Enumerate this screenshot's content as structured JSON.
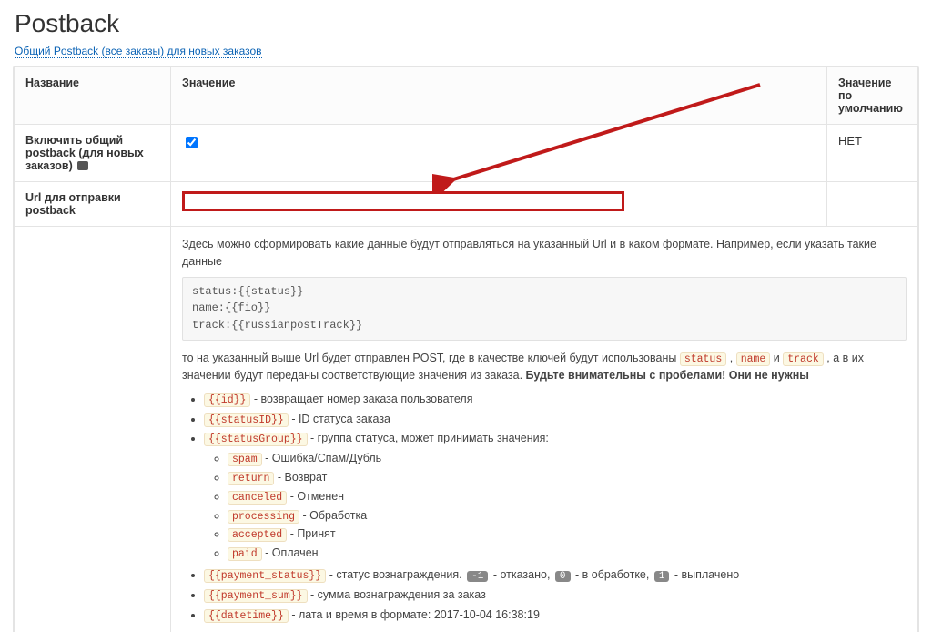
{
  "page": {
    "title": "Postback",
    "link_text": "Общий Postback (все заказы) для новых заказов"
  },
  "headers": {
    "name": "Название",
    "value": "Значение",
    "default": "Значение по умолчанию"
  },
  "rows": {
    "enable": {
      "name": "Включить общий postback (для новых заказов)",
      "default": "НЕТ"
    },
    "url": {
      "name": "Url для отправки postback",
      "value": "",
      "default": ""
    }
  },
  "help": {
    "intro": "Здесь можно сформировать какие данные будут отправляться на указанный Url и в каком формате. Например, если указать такие данные",
    "codebox": "status:{{status}}\nname:{{fio}}\ntrack:{{russianpostTrack}}",
    "sentence2_a": "то на указанный выше Url будет отправлен POST, где в качестве ключей будут использованы ",
    "k1": "status",
    "k2": "name",
    "k3": "track",
    "sentence2_b": ", а в их значении будут переданы соответствующие значения из заказа. ",
    "bold_warn": "Будьте внимательны с пробелами! Они не нужны",
    "li_id_var": "{{id}}",
    "li_id_txt": " - возвращает номер заказа пользователя",
    "li_statusID_var": "{{statusID}}",
    "li_statusID_txt": " - ID статуса заказа",
    "li_statusGroup_var": "{{statusGroup}}",
    "li_statusGroup_txt": " - группа статуса, может принимать значения:",
    "sg_spam_var": "spam",
    "sg_spam_txt": " - Ошибка/Спам/Дубль",
    "sg_return_var": "return",
    "sg_return_txt": " - Возврат",
    "sg_canceled_var": "canceled",
    "sg_canceled_txt": " - Отменен",
    "sg_processing_var": "processing",
    "sg_processing_txt": " - Обработка",
    "sg_accepted_var": "accepted",
    "sg_accepted_txt": " - Принят",
    "sg_paid_var": "paid",
    "sg_paid_txt": " - Оплачен",
    "li_paystat_var": "{{payment_status}}",
    "li_paystat_txt_a": " - статус вознаграждения. ",
    "ps_b1": "-1",
    "ps_t1": " - отказано, ",
    "ps_b2": "0",
    "ps_t2": " - в обработке, ",
    "ps_b3": "1",
    "ps_t3": " - выплачено",
    "li_paysum_var": "{{payment_sum}}",
    "li_paysum_txt": " - сумма вознаграждения за заказ",
    "li_datetime_var": "{{datetime}}",
    "li_datetime_txt": " - лата и время в формате: 2017-10-04 16:38:19"
  }
}
